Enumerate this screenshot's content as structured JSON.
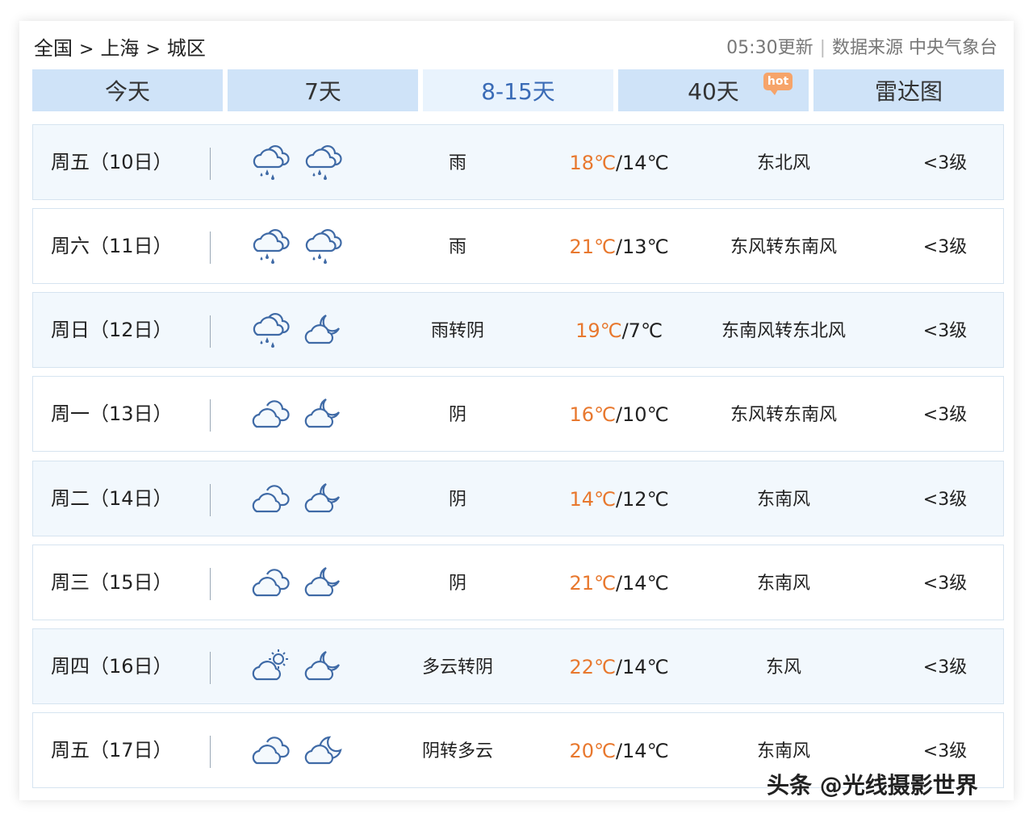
{
  "breadcrumb": {
    "country": "全国",
    "city": "上海",
    "district": "城区",
    "sep": ">"
  },
  "source": {
    "update_time": "05:30更新",
    "divider": "|",
    "source_label": "数据来源 中央气象台"
  },
  "tabs": [
    {
      "label": "今天",
      "active": false
    },
    {
      "label": "7天",
      "active": false
    },
    {
      "label": "8-15天",
      "active": true
    },
    {
      "label": "40天",
      "active": false,
      "badge": "hot"
    },
    {
      "label": "雷达图",
      "active": false
    }
  ],
  "colors": {
    "accent": "#3a6bb6",
    "tab_bg": "#cfe3f8",
    "tab_active_bg": "#e9f3fd",
    "high_temp": "#e8782e",
    "hot_badge": "#f6a46a"
  },
  "forecast": [
    {
      "day": "周五（10日）",
      "icon_day": "rain-icon",
      "icon_night": "rain-icon",
      "weather": "雨",
      "high": "18℃",
      "low": "/14℃",
      "wind": "东北风",
      "level": "<3级"
    },
    {
      "day": "周六（11日）",
      "icon_day": "rain-icon",
      "icon_night": "rain-icon",
      "weather": "雨",
      "high": "21℃",
      "low": "/13℃",
      "wind": "东风转东南风",
      "level": "<3级"
    },
    {
      "day": "周日（12日）",
      "icon_day": "rain-icon",
      "icon_night": "cloudy-night-icon",
      "weather": "雨转阴",
      "high": "19℃",
      "low": "/7℃",
      "wind": "东南风转东北风",
      "level": "<3级"
    },
    {
      "day": "周一（13日）",
      "icon_day": "overcast-icon",
      "icon_night": "cloudy-night-icon",
      "weather": "阴",
      "high": "16℃",
      "low": "/10℃",
      "wind": "东风转东南风",
      "level": "<3级"
    },
    {
      "day": "周二（14日）",
      "icon_day": "overcast-icon",
      "icon_night": "cloudy-night-icon",
      "weather": "阴",
      "high": "14℃",
      "low": "/12℃",
      "wind": "东南风",
      "level": "<3级"
    },
    {
      "day": "周三（15日）",
      "icon_day": "overcast-icon",
      "icon_night": "cloudy-night-icon",
      "weather": "阴",
      "high": "21℃",
      "low": "/14℃",
      "wind": "东南风",
      "level": "<3级"
    },
    {
      "day": "周四（16日）",
      "icon_day": "partly-cloudy-day-icon",
      "icon_night": "cloudy-night-icon",
      "weather": "多云转阴",
      "high": "22℃",
      "low": "/14℃",
      "wind": "东风",
      "level": "<3级"
    },
    {
      "day": "周五（17日）",
      "icon_day": "overcast-icon",
      "icon_night": "partly-cloudy-night-icon",
      "weather": "阴转多云",
      "high": "20℃",
      "low": "/14℃",
      "wind": "东南风",
      "level": "<3级"
    }
  ],
  "watermark": "头条 @光线摄影世界"
}
